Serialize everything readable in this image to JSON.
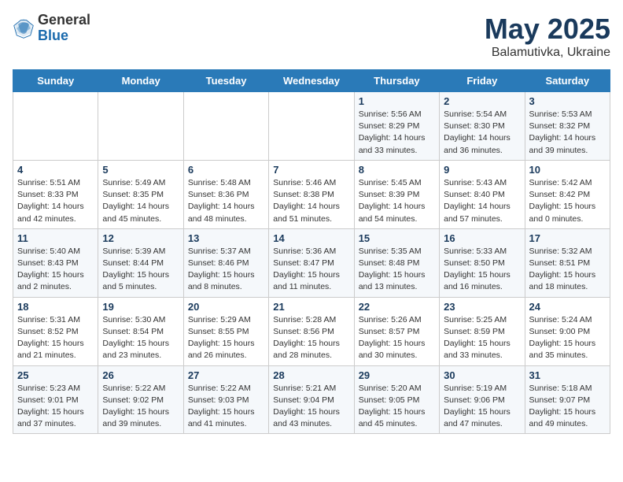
{
  "header": {
    "logo_general": "General",
    "logo_blue": "Blue",
    "month_year": "May 2025",
    "location": "Balamutivka, Ukraine"
  },
  "days_of_week": [
    "Sunday",
    "Monday",
    "Tuesday",
    "Wednesday",
    "Thursday",
    "Friday",
    "Saturday"
  ],
  "weeks": [
    [
      {
        "day": "",
        "content": ""
      },
      {
        "day": "",
        "content": ""
      },
      {
        "day": "",
        "content": ""
      },
      {
        "day": "",
        "content": ""
      },
      {
        "day": "1",
        "content": "Sunrise: 5:56 AM\nSunset: 8:29 PM\nDaylight: 14 hours\nand 33 minutes."
      },
      {
        "day": "2",
        "content": "Sunrise: 5:54 AM\nSunset: 8:30 PM\nDaylight: 14 hours\nand 36 minutes."
      },
      {
        "day": "3",
        "content": "Sunrise: 5:53 AM\nSunset: 8:32 PM\nDaylight: 14 hours\nand 39 minutes."
      }
    ],
    [
      {
        "day": "4",
        "content": "Sunrise: 5:51 AM\nSunset: 8:33 PM\nDaylight: 14 hours\nand 42 minutes."
      },
      {
        "day": "5",
        "content": "Sunrise: 5:49 AM\nSunset: 8:35 PM\nDaylight: 14 hours\nand 45 minutes."
      },
      {
        "day": "6",
        "content": "Sunrise: 5:48 AM\nSunset: 8:36 PM\nDaylight: 14 hours\nand 48 minutes."
      },
      {
        "day": "7",
        "content": "Sunrise: 5:46 AM\nSunset: 8:38 PM\nDaylight: 14 hours\nand 51 minutes."
      },
      {
        "day": "8",
        "content": "Sunrise: 5:45 AM\nSunset: 8:39 PM\nDaylight: 14 hours\nand 54 minutes."
      },
      {
        "day": "9",
        "content": "Sunrise: 5:43 AM\nSunset: 8:40 PM\nDaylight: 14 hours\nand 57 minutes."
      },
      {
        "day": "10",
        "content": "Sunrise: 5:42 AM\nSunset: 8:42 PM\nDaylight: 15 hours\nand 0 minutes."
      }
    ],
    [
      {
        "day": "11",
        "content": "Sunrise: 5:40 AM\nSunset: 8:43 PM\nDaylight: 15 hours\nand 2 minutes."
      },
      {
        "day": "12",
        "content": "Sunrise: 5:39 AM\nSunset: 8:44 PM\nDaylight: 15 hours\nand 5 minutes."
      },
      {
        "day": "13",
        "content": "Sunrise: 5:37 AM\nSunset: 8:46 PM\nDaylight: 15 hours\nand 8 minutes."
      },
      {
        "day": "14",
        "content": "Sunrise: 5:36 AM\nSunset: 8:47 PM\nDaylight: 15 hours\nand 11 minutes."
      },
      {
        "day": "15",
        "content": "Sunrise: 5:35 AM\nSunset: 8:48 PM\nDaylight: 15 hours\nand 13 minutes."
      },
      {
        "day": "16",
        "content": "Sunrise: 5:33 AM\nSunset: 8:50 PM\nDaylight: 15 hours\nand 16 minutes."
      },
      {
        "day": "17",
        "content": "Sunrise: 5:32 AM\nSunset: 8:51 PM\nDaylight: 15 hours\nand 18 minutes."
      }
    ],
    [
      {
        "day": "18",
        "content": "Sunrise: 5:31 AM\nSunset: 8:52 PM\nDaylight: 15 hours\nand 21 minutes."
      },
      {
        "day": "19",
        "content": "Sunrise: 5:30 AM\nSunset: 8:54 PM\nDaylight: 15 hours\nand 23 minutes."
      },
      {
        "day": "20",
        "content": "Sunrise: 5:29 AM\nSunset: 8:55 PM\nDaylight: 15 hours\nand 26 minutes."
      },
      {
        "day": "21",
        "content": "Sunrise: 5:28 AM\nSunset: 8:56 PM\nDaylight: 15 hours\nand 28 minutes."
      },
      {
        "day": "22",
        "content": "Sunrise: 5:26 AM\nSunset: 8:57 PM\nDaylight: 15 hours\nand 30 minutes."
      },
      {
        "day": "23",
        "content": "Sunrise: 5:25 AM\nSunset: 8:59 PM\nDaylight: 15 hours\nand 33 minutes."
      },
      {
        "day": "24",
        "content": "Sunrise: 5:24 AM\nSunset: 9:00 PM\nDaylight: 15 hours\nand 35 minutes."
      }
    ],
    [
      {
        "day": "25",
        "content": "Sunrise: 5:23 AM\nSunset: 9:01 PM\nDaylight: 15 hours\nand 37 minutes."
      },
      {
        "day": "26",
        "content": "Sunrise: 5:22 AM\nSunset: 9:02 PM\nDaylight: 15 hours\nand 39 minutes."
      },
      {
        "day": "27",
        "content": "Sunrise: 5:22 AM\nSunset: 9:03 PM\nDaylight: 15 hours\nand 41 minutes."
      },
      {
        "day": "28",
        "content": "Sunrise: 5:21 AM\nSunset: 9:04 PM\nDaylight: 15 hours\nand 43 minutes."
      },
      {
        "day": "29",
        "content": "Sunrise: 5:20 AM\nSunset: 9:05 PM\nDaylight: 15 hours\nand 45 minutes."
      },
      {
        "day": "30",
        "content": "Sunrise: 5:19 AM\nSunset: 9:06 PM\nDaylight: 15 hours\nand 47 minutes."
      },
      {
        "day": "31",
        "content": "Sunrise: 5:18 AM\nSunset: 9:07 PM\nDaylight: 15 hours\nand 49 minutes."
      }
    ]
  ]
}
